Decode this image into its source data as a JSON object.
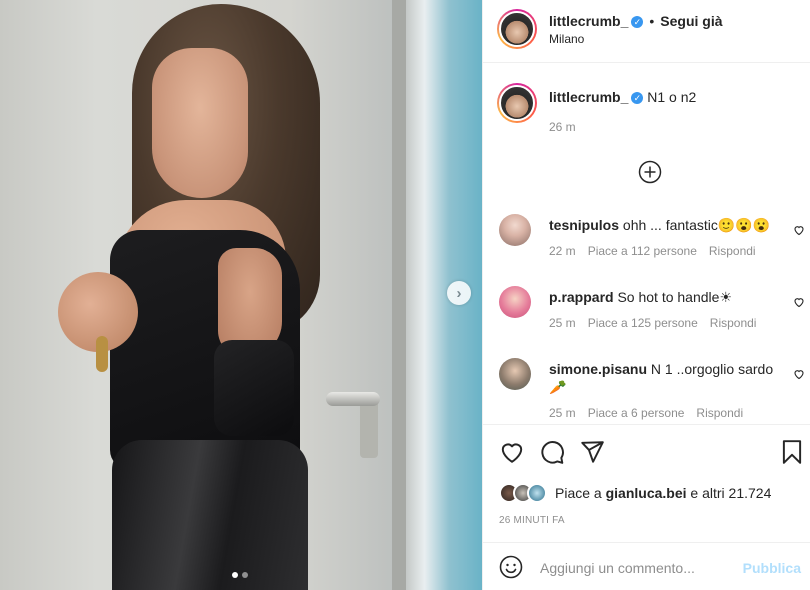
{
  "post": {
    "username": "littlecrumb_",
    "follow_status": "Segui già",
    "location": "Milano",
    "caption": "N1 o n2",
    "caption_time": "26 m",
    "photo_count": 2,
    "active_photo": 1
  },
  "comments": [
    {
      "username": "tesnipulos",
      "text": "ohh ... fantastic🙂😮😮",
      "time": "22 m",
      "likes": "Piace a 112 persone",
      "reply": "Rispondi"
    },
    {
      "username": "p.rappard",
      "text": "So hot to handle☀",
      "time": "25 m",
      "likes": "Piace a 125 persone",
      "reply": "Rispondi"
    },
    {
      "username": "simone.pisanu",
      "text": "N 1 ..orgoglio sardo 🥕",
      "time": "25 m",
      "likes": "Piace a 6 persone",
      "reply": "Rispondi"
    }
  ],
  "likes_summary": {
    "prefix": "Piace a ",
    "user": "gianluca.bei",
    "suffix": " e altri 21.724"
  },
  "post_time": "26 MINUTI FA",
  "comment_box": {
    "placeholder": "Aggiungi un commento...",
    "publish_label": "Pubblica"
  },
  "icons": {
    "verified": "verified-badge-icon",
    "like": "heart-icon",
    "comment": "speech-bubble-icon",
    "share": "paper-plane-icon",
    "save": "bookmark-icon",
    "emoji": "smiley-icon",
    "load_more": "plus-circle-icon",
    "next": "chevron-right-icon"
  },
  "colors": {
    "verified_blue": "#3897f0",
    "muted_text": "#8e8e8e",
    "publish_disabled": "#b2dffc"
  }
}
